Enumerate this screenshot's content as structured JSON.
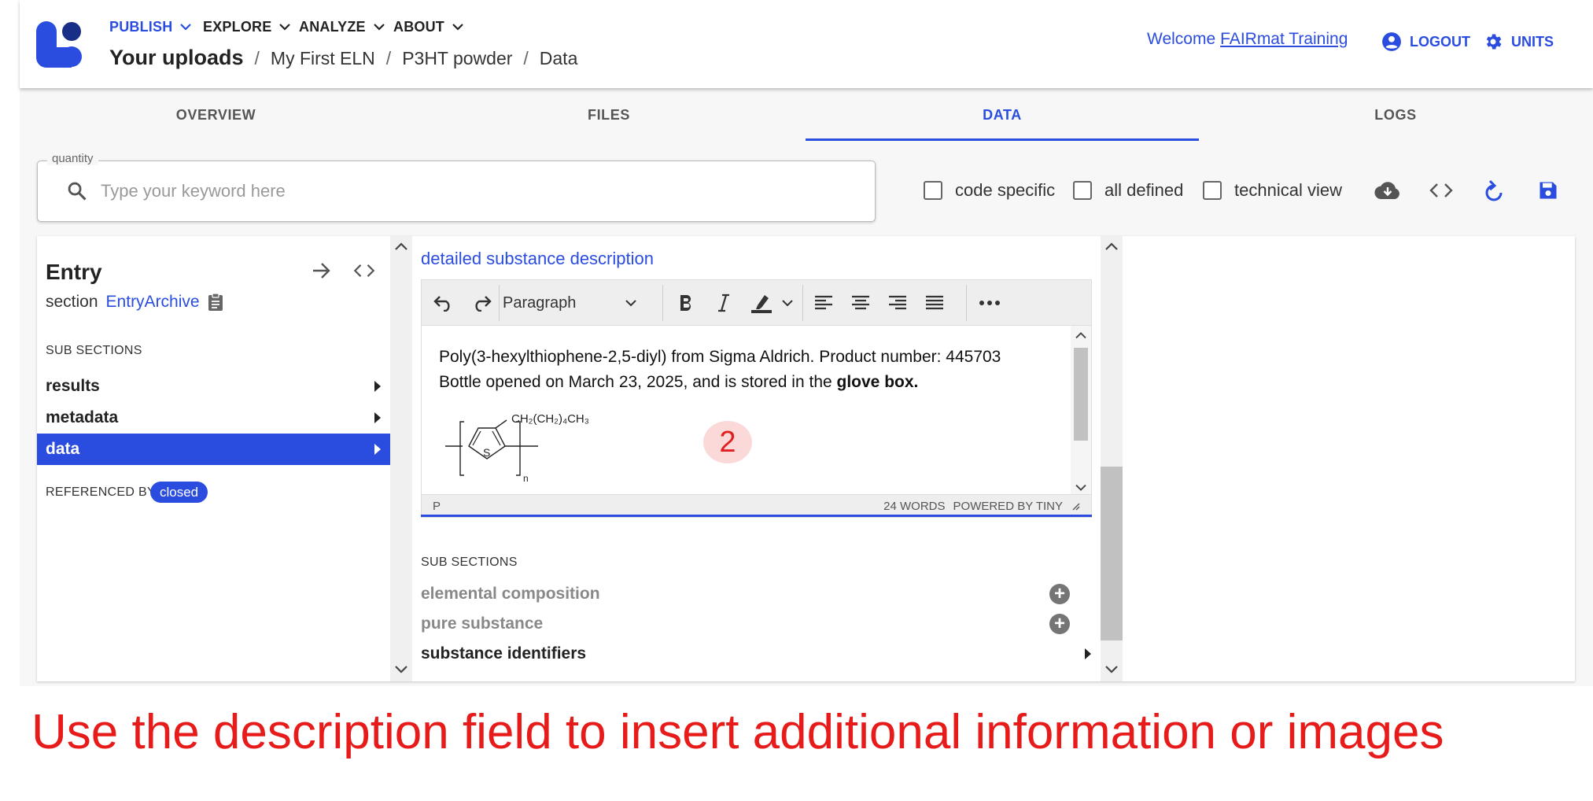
{
  "nav": {
    "publish": "PUBLISH",
    "explore": "EXPLORE",
    "analyze": "ANALYZE",
    "about": "ABOUT"
  },
  "breadcrumb": {
    "root": "Your uploads",
    "items": [
      "My First ELN",
      "P3HT powder",
      "Data"
    ],
    "separator": "/"
  },
  "header": {
    "welcome": "Welcome",
    "user": "FAIRmat Training",
    "logout": "LOGOUT",
    "units": "UNITS"
  },
  "tabs": [
    {
      "label": "OVERVIEW"
    },
    {
      "label": "FILES"
    },
    {
      "label": "DATA"
    },
    {
      "label": "LOGS"
    }
  ],
  "search": {
    "legend": "quantity",
    "placeholder": "Type your keyword here",
    "value": ""
  },
  "filters": {
    "code_specific": "code specific",
    "all_defined": "all defined",
    "technical_view": "technical view"
  },
  "left_pane": {
    "title": "Entry",
    "section_label": "section",
    "section_link": "EntryArchive",
    "subsections_header": "SUB SECTIONS",
    "items": [
      {
        "label": "results"
      },
      {
        "label": "metadata"
      },
      {
        "label": "data"
      }
    ],
    "referenced_by": "REFERENCED BY",
    "closed_badge": "closed"
  },
  "middle_pane": {
    "field_label": "detailed substance description",
    "editor": {
      "block_format": "Paragraph",
      "line1": "Poly(3-hexylthiophene-2,5-diyl) from Sigma Aldrich. Product number: 445703",
      "line2_prefix": "Bottle opened on March 23, 2025, and is stored in the ",
      "line2_bold": "glove box.",
      "structure_label": "CH₂(CH₂)₄CH₃",
      "structure_atom": "S",
      "structure_sub": "n",
      "status_path": "P",
      "word_count": "24 WORDS",
      "powered_by": "POWERED BY TINY"
    },
    "step_badge": "2",
    "subsections_header": "SUB SECTIONS",
    "items": [
      {
        "label": "elemental composition"
      },
      {
        "label": "pure substance"
      },
      {
        "label": "substance identifiers"
      }
    ]
  },
  "caption": "Use the description field to insert additional information or images",
  "colors": {
    "accent": "#2a4cdf",
    "caption_red": "#e81b1b",
    "badge_bg": "#fcd9d9"
  }
}
